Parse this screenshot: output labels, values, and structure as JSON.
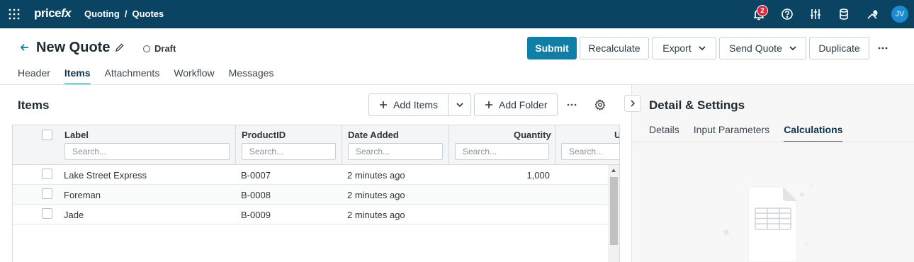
{
  "app": {
    "logo_main": "price",
    "logo_fx": "fx",
    "breadcrumb": [
      "Quoting",
      "/",
      "Quotes"
    ],
    "notification_count": "2",
    "user_initials": "JV",
    "icons": [
      "apps-grid-icon",
      "bell-icon",
      "help-icon",
      "sliders-icon",
      "database-icon",
      "tools-icon"
    ]
  },
  "quote": {
    "title": "New Quote",
    "status": "Draft"
  },
  "actions": {
    "submit": "Submit",
    "recalculate": "Recalculate",
    "export": "Export",
    "send_quote": "Send Quote",
    "duplicate": "Duplicate"
  },
  "tabs": [
    "Header",
    "Items",
    "Attachments",
    "Workflow",
    "Messages"
  ],
  "active_tab": "Items",
  "items": {
    "title": "Items",
    "add_items": "Add Items",
    "add_folder": "Add Folder",
    "columns": [
      "Label",
      "ProductID",
      "Date Added",
      "Quantity",
      "U"
    ],
    "filter_placeholder": "Search...",
    "rows": [
      {
        "label": "Lake Street Express",
        "product_id": "B-0007",
        "date_added": "2 minutes ago",
        "quantity": "1,000"
      },
      {
        "label": "Foreman",
        "product_id": "B-0008",
        "date_added": "2 minutes ago",
        "quantity": ""
      },
      {
        "label": "Jade",
        "product_id": "B-0009",
        "date_added": "2 minutes ago",
        "quantity": ""
      }
    ]
  },
  "detail": {
    "title": "Detail & Settings",
    "tabs": [
      "Details",
      "Input Parameters",
      "Calculations"
    ],
    "active_tab": "Calculations"
  },
  "colors": {
    "topbar": "#0b4462",
    "primary": "#0f7fa8",
    "badge": "#e0283d",
    "avatar": "#1a8bd0"
  }
}
